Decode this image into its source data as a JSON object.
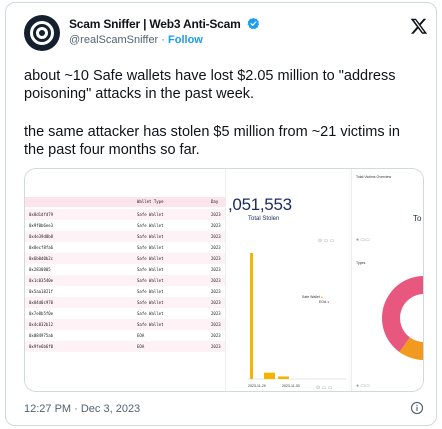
{
  "tweet": {
    "author_name": "Scam Sniffer | Web3 Anti-Scam",
    "handle": "@realScamSniffer",
    "separator": " · ",
    "follow_label": "Follow",
    "paragraph_1": "about ~10 Safe wallets have lost $2.05 million to \"address poisoning\" attacks in the past week.",
    "paragraph_2": "the same attacker has stolen $5 million from ~21 victims in the past four months so far.",
    "timestamp": "12:27 PM · Dec 3, 2023"
  },
  "colors": {
    "accent": "#1d9bf0",
    "verified": "#1d9bf0",
    "bar": "#f5b400",
    "donut_orange": "#f29a1f",
    "donut_pink": "#e8577d",
    "table_band": "#fde3ec",
    "metric_text": "#1b2a5e"
  },
  "icons": {
    "avatar": "scam-sniffer-logo",
    "verified": "verified-badge-icon",
    "brand": "x-logo-icon",
    "info": "info-icon"
  },
  "media": {
    "table": {
      "headers": [
        "Wallet Type",
        "Day"
      ],
      "rows": [
        {
          "address": "0x8d1dfd79",
          "type": "Safe Wallet",
          "day": "2023"
        },
        {
          "address": "0x9f0b6ee3",
          "type": "Safe Wallet",
          "day": "2023"
        },
        {
          "address": "0x4e39d0b8",
          "type": "Safe Wallet",
          "day": "2023"
        },
        {
          "address": "0x8ecf8fa6",
          "type": "Safe Wallet",
          "day": "2023"
        },
        {
          "address": "0x6b0d0b2c",
          "type": "Safe Wallet",
          "day": "2023"
        },
        {
          "address": "0x2830805",
          "type": "Safe Wallet",
          "day": "2023"
        },
        {
          "address": "0x1c03540e",
          "type": "Safe Wallet",
          "day": "2023"
        },
        {
          "address": "0x5aa1821f",
          "type": "Safe Wallet",
          "day": "2023"
        },
        {
          "address": "0x84d0c970",
          "type": "Safe Wallet",
          "day": "2023"
        },
        {
          "address": "0x7e8b5f0e",
          "type": "Safe Wallet",
          "day": "2023"
        },
        {
          "address": "0x4c832b12",
          "type": "Safe Wallet",
          "day": "2023"
        },
        {
          "address": "0x084975ab",
          "type": "EOA",
          "day": "2023"
        },
        {
          "address": "0x9fe6b6f0",
          "type": "EOA",
          "day": "2023"
        }
      ]
    },
    "metric": {
      "value": ",051,553",
      "label": "Total Stolen"
    },
    "bar_chart": {
      "series": [
        "Safe Wallet",
        "EOA"
      ],
      "values": [
        1.0,
        0.05,
        0.02
      ],
      "x_ticks": [
        "2023-11-29",
        "2023-11-30"
      ]
    },
    "right": {
      "title": "Total Victims Overview",
      "value_fragment": "To",
      "types_title": "Types"
    },
    "donut": {
      "slices": [
        {
          "label": "Safe Wallet",
          "value": 0.6
        },
        {
          "label": "EOA",
          "value": 0.4
        }
      ]
    }
  }
}
